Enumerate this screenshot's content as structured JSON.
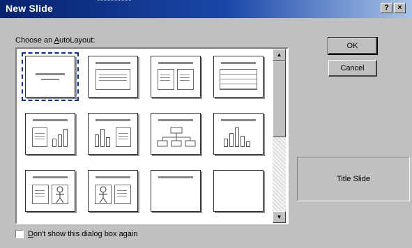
{
  "dialog": {
    "title": "New Slide",
    "help_button": "?",
    "close_button": "×",
    "prompt_prefix": "Choose an ",
    "prompt_access": "A",
    "prompt_suffix": "utoLayout:",
    "ok_label": "OK",
    "cancel_label": "Cancel",
    "preview_label": "Title Slide",
    "checkbox_access": "D",
    "checkbox_label_rest": "on't show this dialog box again",
    "checkbox_checked": false
  },
  "layouts": [
    {
      "name": "title-slide",
      "selected": true
    },
    {
      "name": "bulleted-list"
    },
    {
      "name": "two-column-text"
    },
    {
      "name": "table"
    },
    {
      "name": "text-and-chart"
    },
    {
      "name": "chart-and-text"
    },
    {
      "name": "organization-chart"
    },
    {
      "name": "chart"
    },
    {
      "name": "text-and-clip-art"
    },
    {
      "name": "clip-art-and-text"
    },
    {
      "name": "title-only"
    },
    {
      "name": "blank"
    }
  ],
  "scrollbar": {
    "up_icon": "▲",
    "down_icon": "▼"
  },
  "colors": {
    "selection_outline": "#0b2f8c",
    "titlebar_start": "#08226e",
    "titlebar_end": "#a9c3e8"
  }
}
